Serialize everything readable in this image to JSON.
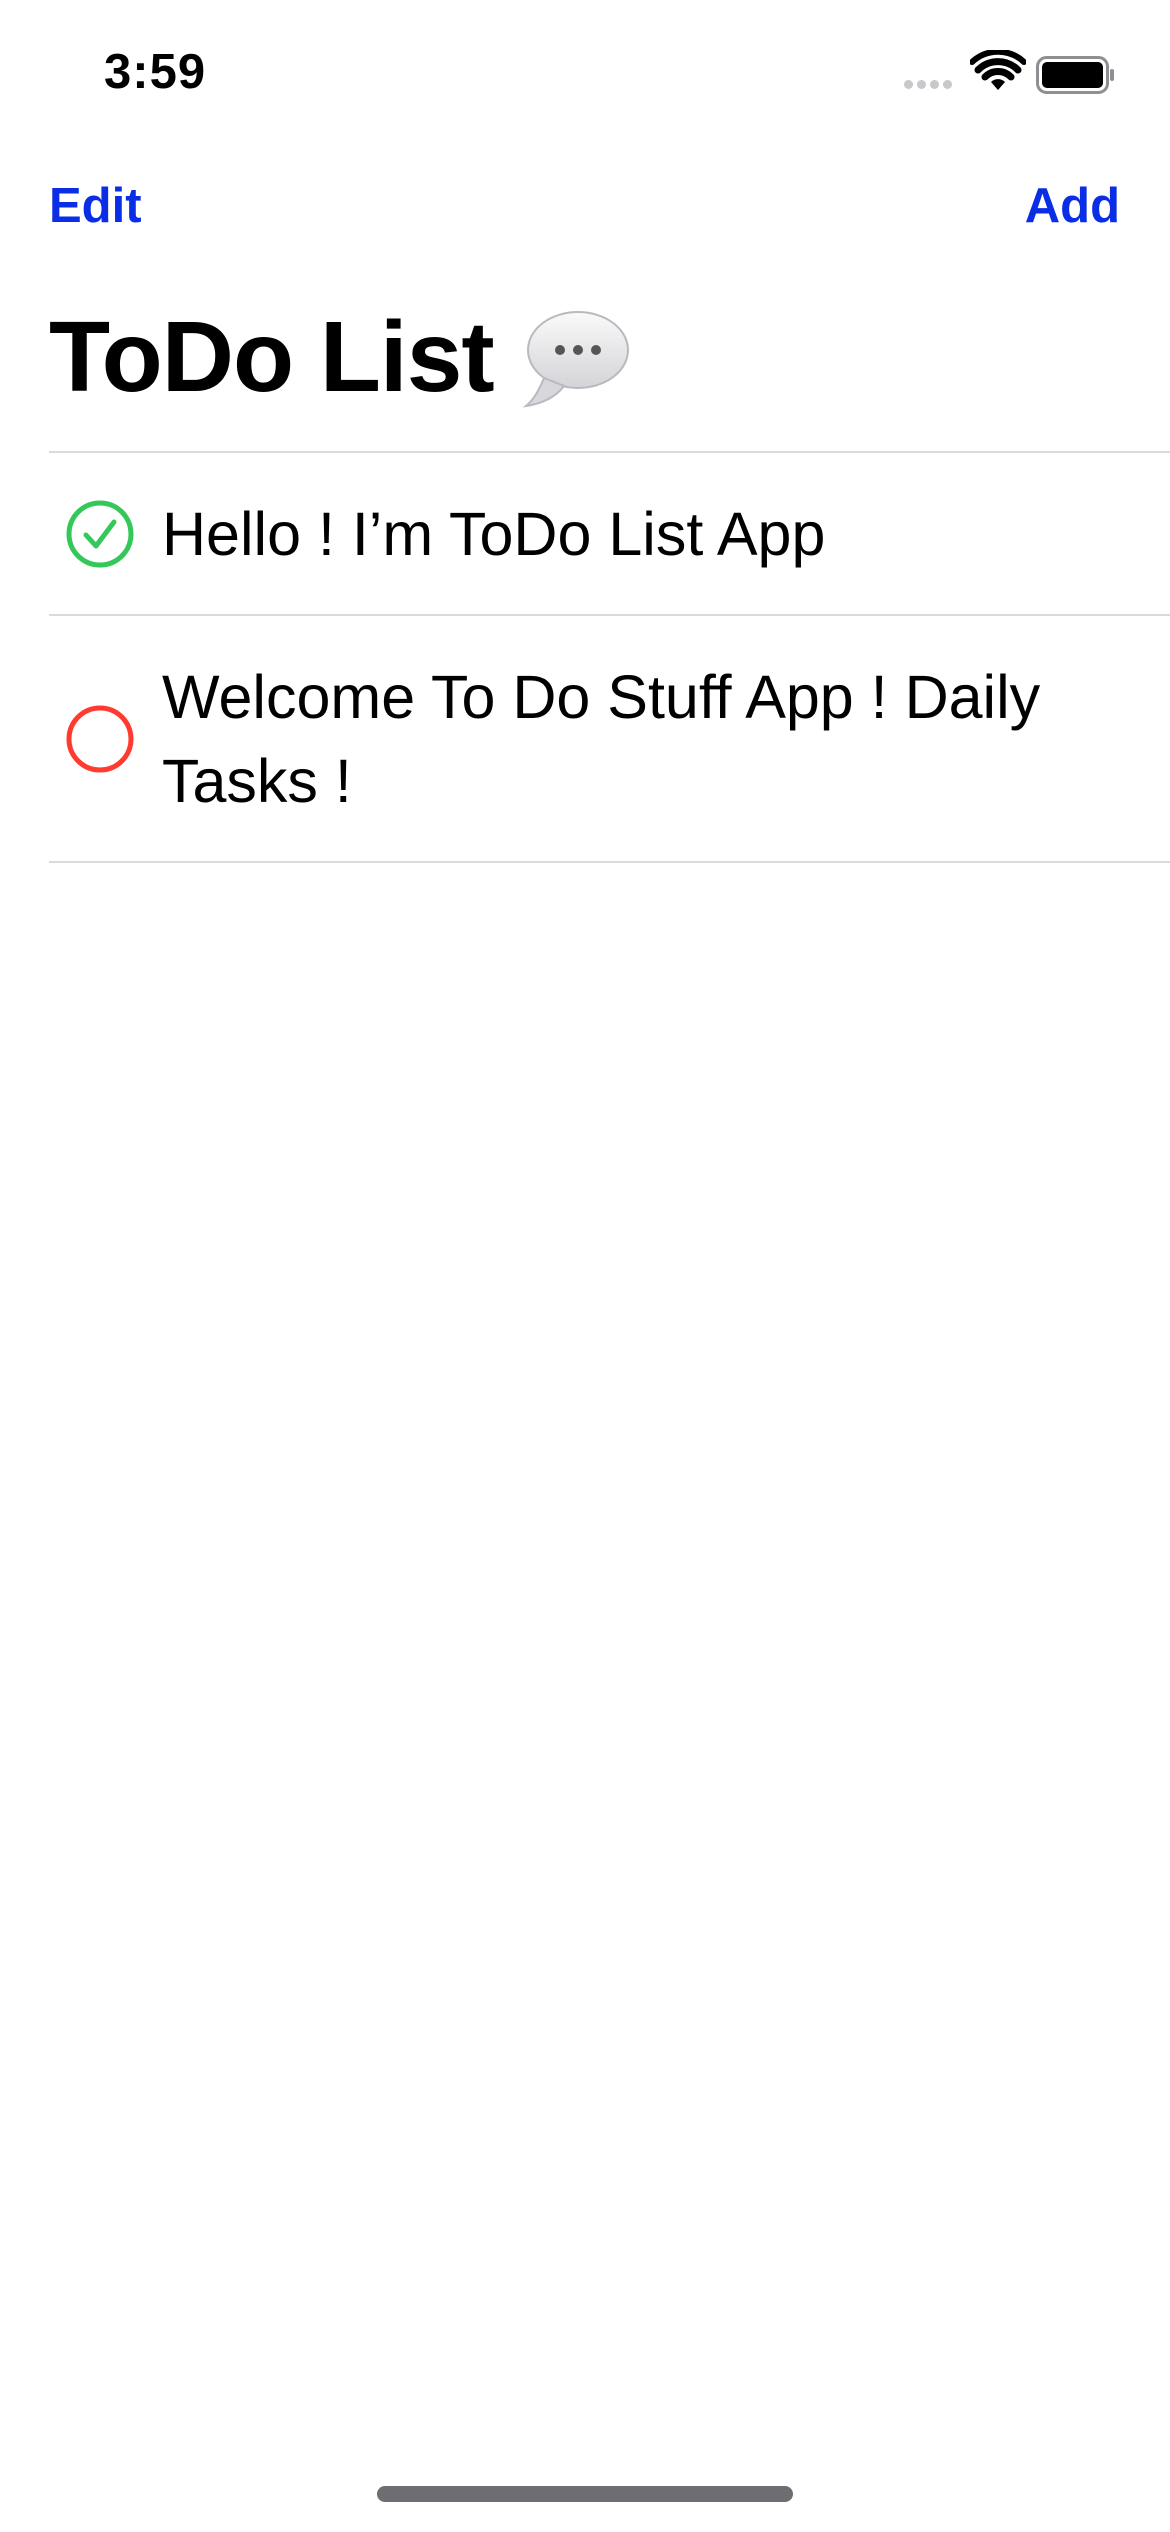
{
  "status_bar": {
    "time": "3:59"
  },
  "nav": {
    "edit_label": "Edit",
    "add_label": "Add"
  },
  "title": {
    "text": "ToDo List"
  },
  "todos": [
    {
      "text": "Hello ! I’m ToDo List App",
      "completed": true
    },
    {
      "text": "Welcome To Do Stuff App ! Daily Tasks !",
      "completed": false
    }
  ],
  "colors": {
    "accent": "#0a2ee6",
    "complete": "#34c759",
    "incomplete": "#ff3b30",
    "divider": "#d9d9de"
  },
  "icons": {
    "title_icon": "speech-bubble-icon",
    "completed_icon": "checkmark-circle-icon",
    "incomplete_icon": "empty-circle-icon"
  }
}
